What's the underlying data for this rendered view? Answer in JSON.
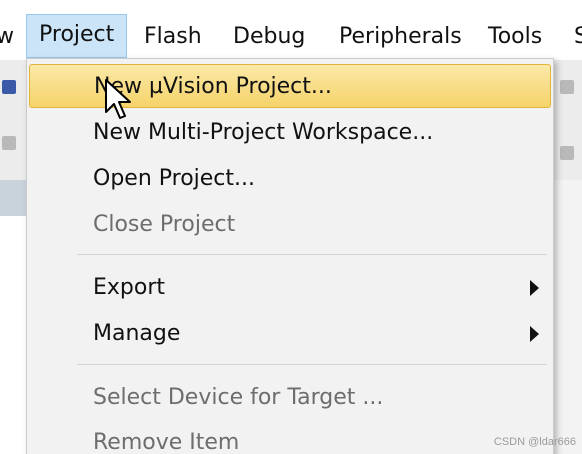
{
  "menubar": {
    "items": [
      {
        "label": "w"
      },
      {
        "label": "Project"
      },
      {
        "label": "Flash"
      },
      {
        "label": "Debug"
      },
      {
        "label": "Peripherals"
      },
      {
        "label": "Tools"
      },
      {
        "label": "S"
      }
    ]
  },
  "project_menu": {
    "items": [
      {
        "label": "New µVision Project...",
        "enabled": true,
        "highlighted": true
      },
      {
        "label": "New Multi-Project Workspace...",
        "enabled": true
      },
      {
        "label": "Open Project...",
        "enabled": true
      },
      {
        "label": "Close Project",
        "enabled": false
      },
      {
        "label": "Export",
        "enabled": true,
        "submenu": true
      },
      {
        "label": "Manage",
        "enabled": true,
        "submenu": true
      },
      {
        "label": "Select Device for Target ...",
        "enabled": false
      },
      {
        "label": "Remove Item",
        "enabled": false
      }
    ]
  },
  "watermark": "CSDN @ldar666",
  "colors": {
    "highlight": "#f6d36a",
    "active_menu": "#cce4f7",
    "disabled_text": "#6d6d6d"
  }
}
